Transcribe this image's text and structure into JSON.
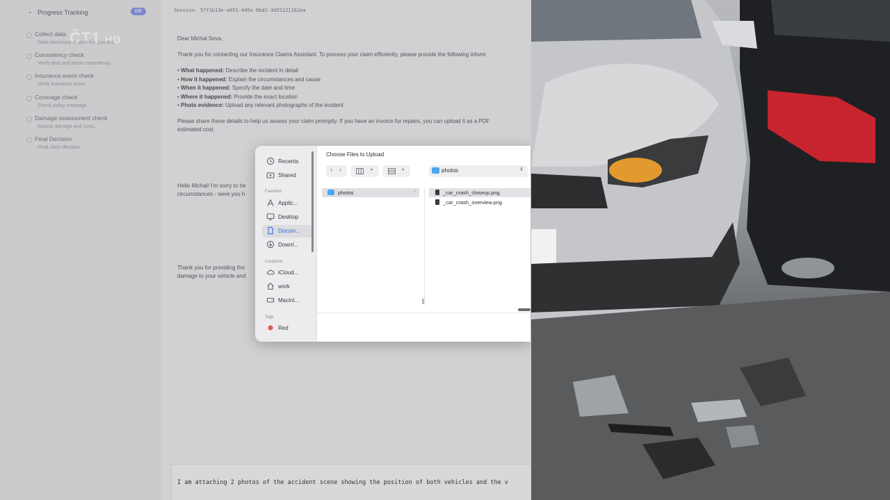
{
  "sidebar": {
    "title": "Progress Tracking",
    "badge": "0/6",
    "watermark": {
      "logo": "ČT1",
      "hd": "HD"
    },
    "steps": [
      {
        "title": "Collect data",
        "subtitle": "Data necessary to start the process."
      },
      {
        "title": "Consistency check",
        "subtitle": "Verify data and photo consistency."
      },
      {
        "title": "Insurance event check",
        "subtitle": "Verify insurance event."
      },
      {
        "title": "Coverage check",
        "subtitle": "Check policy coverage."
      },
      {
        "title": "Damage assessment check",
        "subtitle": "Assess damage and costs."
      },
      {
        "title": "Final Decision",
        "subtitle": "Final claim decision."
      }
    ]
  },
  "chat": {
    "session": "Session: 57f1b13e-a051-445e-8bd1-3d55121162ea",
    "greeting": "Dear Michal Sova,",
    "intro": "Thank you for contacting our Insurance Claims Assistant. To process your claim efficiently, please provide the following inform",
    "requirements": [
      {
        "label": "What happened:",
        "text": " Describe the incident in detail"
      },
      {
        "label": "How it happened:",
        "text": " Explain the circumstances and cause"
      },
      {
        "label": "When it happened:",
        "text": " Specify the date and time"
      },
      {
        "label": "Where it happened:",
        "text": " Provide the exact location"
      },
      {
        "label": "Photo evidence:",
        "text": " Upload any relevant photographs of the incident"
      }
    ],
    "closing_line1": "Please share these details to help us assess your claim promptly. If you have an invoice for repairs, you can upload it as a PDF",
    "closing_line2": "estimated cost.",
    "reply1_line1": "Hello Michal! I'm sorry to he",
    "reply1_line2": "circumstances - were you h",
    "reply2_line1": "Thank you for providing tho",
    "reply2_line2": "damage to your vehicle and",
    "composer_text": "I am attaching 2 photos of the accident scene showing the position of both vehicles and the v"
  },
  "dialog": {
    "title": "Choose Files to Upload",
    "sidebar": {
      "top_items": [
        "Recents",
        "Shared"
      ],
      "favorites_header": "Favorites",
      "favorites": [
        "Applic...",
        "Desktop",
        "Docum...",
        "Downl..."
      ],
      "locations_header": "Locations",
      "locations": [
        "iCloud...",
        "work",
        "Macint..."
      ],
      "tags_header": "Tags",
      "tags": [
        "Red"
      ]
    },
    "path": "photos",
    "column1": [
      "photos"
    ],
    "files": [
      "_car_crash_closeup.png",
      "_car_crash_overview.png"
    ]
  },
  "colors": {
    "accent_badge": "#7d87c9",
    "selected_blue": "#2e6fd8",
    "folder_blue": "#4aa8f0",
    "tag_red": "#e05a55"
  }
}
